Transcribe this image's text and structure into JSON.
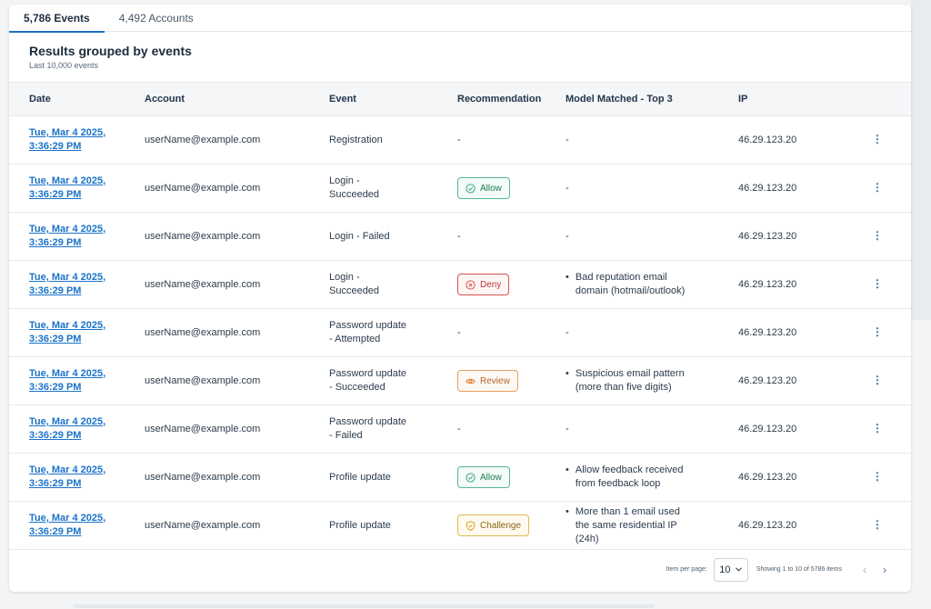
{
  "tabs": [
    {
      "label": "5,786 Events"
    },
    {
      "label": "4,492 Accounts"
    }
  ],
  "header": {
    "title": "Results grouped by events",
    "subtitle": "Last 10,000 events"
  },
  "columns": [
    "Date",
    "Account",
    "Event",
    "Recommendation",
    "Model Matched - Top 3",
    "IP"
  ],
  "rows": [
    {
      "date": "Tue, Mar 4 2025,",
      "time": "3:36:29 PM",
      "account": "userName@example.com",
      "event": "Registration",
      "recommendation": "-",
      "model": "-",
      "ip": "46.29.123.20"
    },
    {
      "date": "Tue, Mar 4 2025,",
      "time": "3:36:29 PM",
      "account": "userName@example.com",
      "event": "Login - Succeeded",
      "recommendation": "Allow",
      "model": "-",
      "ip": "46.29.123.20"
    },
    {
      "date": "Tue, Mar 4 2025,",
      "time": "3:36:29 PM",
      "account": "userName@example.com",
      "event": "Login - Failed",
      "recommendation": "-",
      "model": "-",
      "ip": "46.29.123.20"
    },
    {
      "date": "Tue, Mar 4 2025,",
      "time": "3:36:29 PM",
      "account": "userName@example.com",
      "event": "Login - Succeeded",
      "recommendation": "Deny",
      "model": "Bad reputation email domain (hotmail/outlook)",
      "ip": "46.29.123.20"
    },
    {
      "date": "Tue, Mar 4 2025,",
      "time": "3:36:29 PM",
      "account": "userName@example.com",
      "event": "Password update - Attempted",
      "recommendation": "-",
      "model": "-",
      "ip": "46.29.123.20"
    },
    {
      "date": "Tue, Mar 4 2025,",
      "time": "3:36:29 PM",
      "account": "userName@example.com",
      "event": "Password update - Succeeded",
      "recommendation": "Review",
      "model": "Suspicious email pattern (more than five digits)",
      "ip": "46.29.123.20"
    },
    {
      "date": "Tue, Mar 4 2025,",
      "time": "3:36:29 PM",
      "account": "userName@example.com",
      "event": "Password update - Failed",
      "recommendation": "-",
      "model": "-",
      "ip": "46.29.123.20"
    },
    {
      "date": "Tue, Mar 4 2025,",
      "time": "3:36:29 PM",
      "account": "userName@example.com",
      "event": "Profile update",
      "recommendation": "Allow",
      "model": "Allow feedback received from feedback loop",
      "ip": "46.29.123.20"
    },
    {
      "date": "Tue, Mar 4 2025,",
      "time": "3:36:29 PM",
      "account": "userName@example.com",
      "event": "Profile update",
      "recommendation": "Challenge",
      "model": "More than 1 email used the same residential IP (24h)",
      "ip": "46.29.123.20"
    }
  ],
  "row_menu_glyph": "⋮",
  "footer": {
    "per_page_label": "Item per page:",
    "per_page_value": "10",
    "showing": "Showing 1 to 10  of 5786 items",
    "prev_glyph": "‹",
    "next_glyph": "›"
  },
  "colors": {
    "accent": "#1a73c9",
    "allow": "#1f7a52",
    "deny": "#b83a35",
    "review": "#b5662a",
    "challenge": "#8a6512"
  }
}
